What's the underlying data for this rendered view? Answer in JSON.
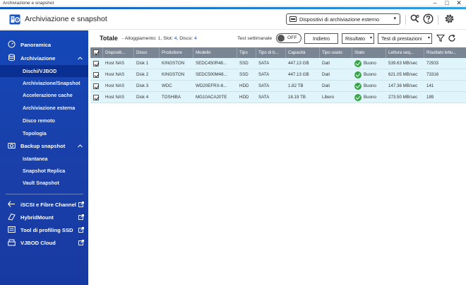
{
  "window": {
    "title": "Archiviazione e snapshot",
    "controls": [
      "–",
      "□",
      "✕"
    ]
  },
  "header": {
    "title": "Archiviazione e snapshot",
    "external_storage_button": "Dispositivi di archiviazione esterno",
    "icons": [
      "search-settings-icon",
      "help-icon",
      "settings-icon"
    ]
  },
  "sidebar": {
    "panoramica": "Panoramica",
    "archiviazione": "Archiviazione",
    "archiviazione_items": [
      "Dischi/VJBOD",
      "Archiviazione/Snapshot",
      "Accelerazione cache",
      "Archiviazione esterna",
      "Disco remoto",
      "Topologia"
    ],
    "backup_snapshot": "Backup snapshot",
    "backup_items": [
      "Istantanea",
      "Snapshot Replica",
      "Vault Snapshot"
    ],
    "external_links": [
      "iSCSI e Fibre Channel",
      "HybridMount",
      "Tool di profiling SSD",
      "VJBOD Cloud"
    ],
    "active_item": "Dischi/VJBOD"
  },
  "toolbar": {
    "total_label": "Totale",
    "info_prefix": "- Alloggiamento:",
    "enclosure_count": "1",
    "slot_label": ", Slot:",
    "slot_count": "4",
    "disk_label": ", Disco:",
    "disk_count": "4",
    "weekly_test_label": "Test settimanale",
    "weekly_test_state": "OFF",
    "back_button": "Indietro",
    "result_button": "Risultato",
    "performance_test_button": "Test di prestazioni"
  },
  "table": {
    "columns": [
      "Dispositi...",
      "Disco",
      "Produttore",
      "Modello",
      "Tipo",
      "Tipo di b...",
      "Capacità",
      "Tipo usato",
      "Stato",
      "Lettura seq...",
      "Risultato lettu..."
    ],
    "rows": [
      {
        "device": "Host NAS",
        "disk": "Disk 1",
        "manufacturer": "KINGSTON",
        "model": "SEDC450R48...",
        "type": "SSD",
        "bus": "SATA",
        "capacity": "447.13 GB",
        "usage": "Dati",
        "status": "Buono",
        "seq_read": "539.63 MB/sec",
        "read_result": "72933"
      },
      {
        "device": "Host NAS",
        "disk": "Disk 2",
        "manufacturer": "KINGSTON",
        "model": "SEDC500M48...",
        "type": "SSD",
        "bus": "SATA",
        "capacity": "447.13 GB",
        "usage": "Dati",
        "status": "Buono",
        "seq_read": "621.05 MB/sec",
        "read_result": "73316"
      },
      {
        "device": "Host NAS",
        "disk": "Disk 3",
        "manufacturer": "WDC",
        "model": "WD20EFRX-6...",
        "type": "HDD",
        "bus": "SATA",
        "capacity": "1.82 TB",
        "usage": "Dati",
        "status": "Buono",
        "seq_read": "147.36 MB/sec",
        "read_result": "141"
      },
      {
        "device": "Host NAS",
        "disk": "Disk 4",
        "manufacturer": "TOSHIBA",
        "model": "MG10ACA20TE",
        "type": "HDD",
        "bus": "SATA",
        "capacity": "18.19 TB",
        "usage": "Libero",
        "status": "Buono",
        "seq_read": "273.50 MB/sec",
        "read_result": "189"
      }
    ]
  },
  "colors": {
    "accent": "#1447b8",
    "active_nav": "#0a2f93",
    "row_bg": "#dff5fb",
    "header_bg": "#7a8594",
    "status_ok": "#37a647"
  }
}
